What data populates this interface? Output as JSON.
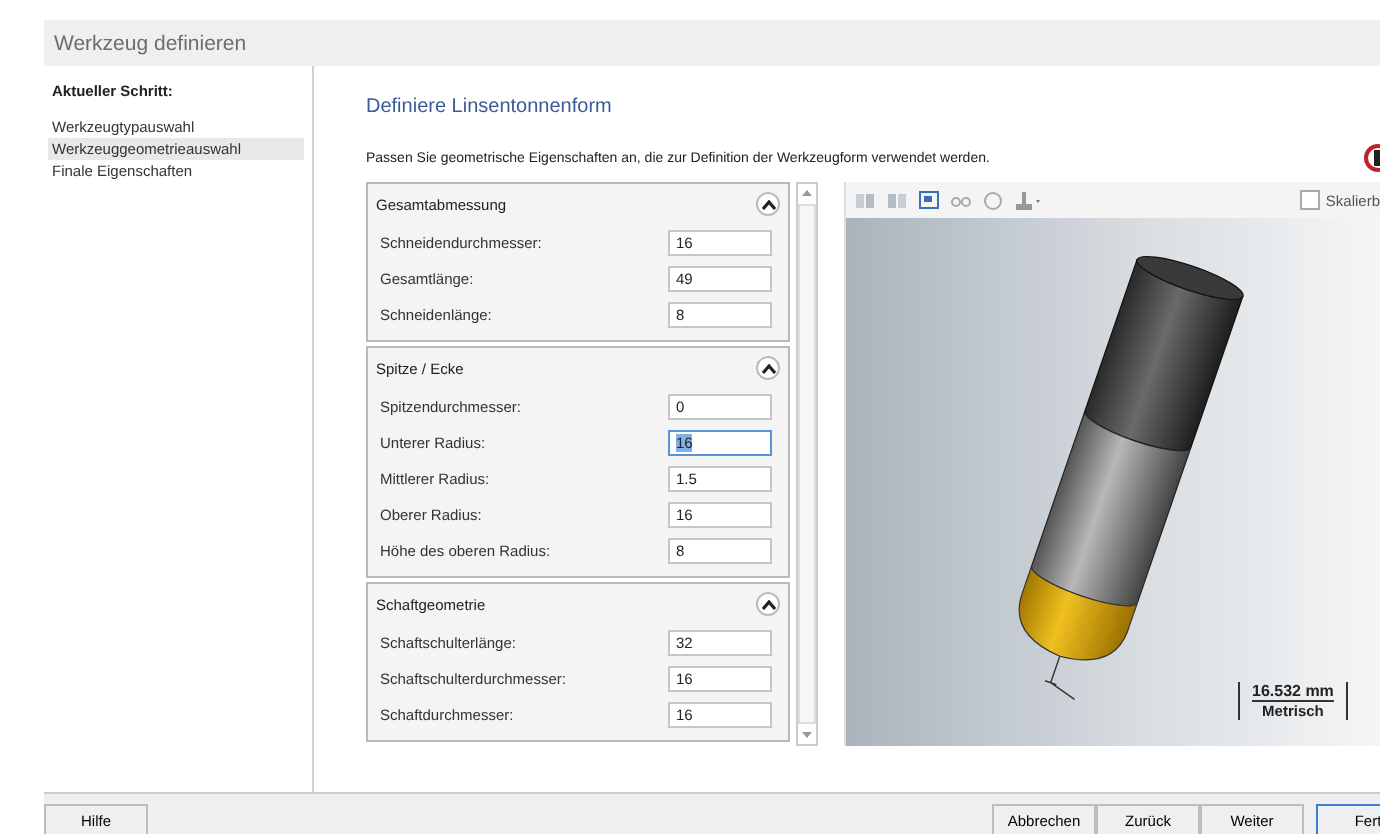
{
  "window": {
    "title": "Werkzeug definieren"
  },
  "sidebar": {
    "heading": "Aktueller Schritt:",
    "items": [
      {
        "label": "Werkzeugtypauswahl",
        "selected": false
      },
      {
        "label": "Werkzeuggeometrieauswahl",
        "selected": true
      },
      {
        "label": "Finale Eigenschaften",
        "selected": false
      }
    ]
  },
  "page": {
    "title": "Definiere Linsentonnenform",
    "instructions": "Passen Sie geometrische Eigenschaften an, die zur Definition der Werkzeugform verwendet werden."
  },
  "groups": [
    {
      "title": "Gesamtabmessung",
      "expanded": true,
      "fields": [
        {
          "label": "Schneidendurchmesser:",
          "value": "16",
          "highlighted": false
        },
        {
          "label": "Gesamtlänge:",
          "value": "49",
          "highlighted": false
        },
        {
          "label": "Schneidenlänge:",
          "value": "8",
          "highlighted": false
        }
      ]
    },
    {
      "title": "Spitze / Ecke",
      "expanded": true,
      "fields": [
        {
          "label": "Spitzendurchmesser:",
          "value": "0",
          "highlighted": false
        },
        {
          "label": "Unterer Radius:",
          "value": "16",
          "highlighted": true
        },
        {
          "label": "Mittlerer Radius:",
          "value": "1.5",
          "highlighted": false
        },
        {
          "label": "Oberer Radius:",
          "value": "16",
          "highlighted": false
        },
        {
          "label": "Höhe des oberen Radius:",
          "value": "8",
          "highlighted": false
        }
      ]
    },
    {
      "title": "Schaftgeometrie",
      "expanded": true,
      "fields": [
        {
          "label": "Schaftschulterlänge:",
          "value": "32",
          "highlighted": false
        },
        {
          "label": "Schaftschulterdurchmesser:",
          "value": "16",
          "highlighted": false
        },
        {
          "label": "Schaftdurchmesser:",
          "value": "16",
          "highlighted": false
        }
      ]
    }
  ],
  "preview": {
    "scale_checkbox": {
      "label": "Skalierb",
      "checked": false
    },
    "scale": {
      "value": "16.532 mm",
      "unit": "Metrisch"
    }
  },
  "buttons": [
    {
      "label": "Hilfe",
      "default": false
    },
    {
      "label": "Abbrechen",
      "default": false
    },
    {
      "label": "Zurück",
      "default": false
    },
    {
      "label": "Weiter",
      "default": false
    },
    {
      "label": "Fert",
      "default": true
    }
  ]
}
